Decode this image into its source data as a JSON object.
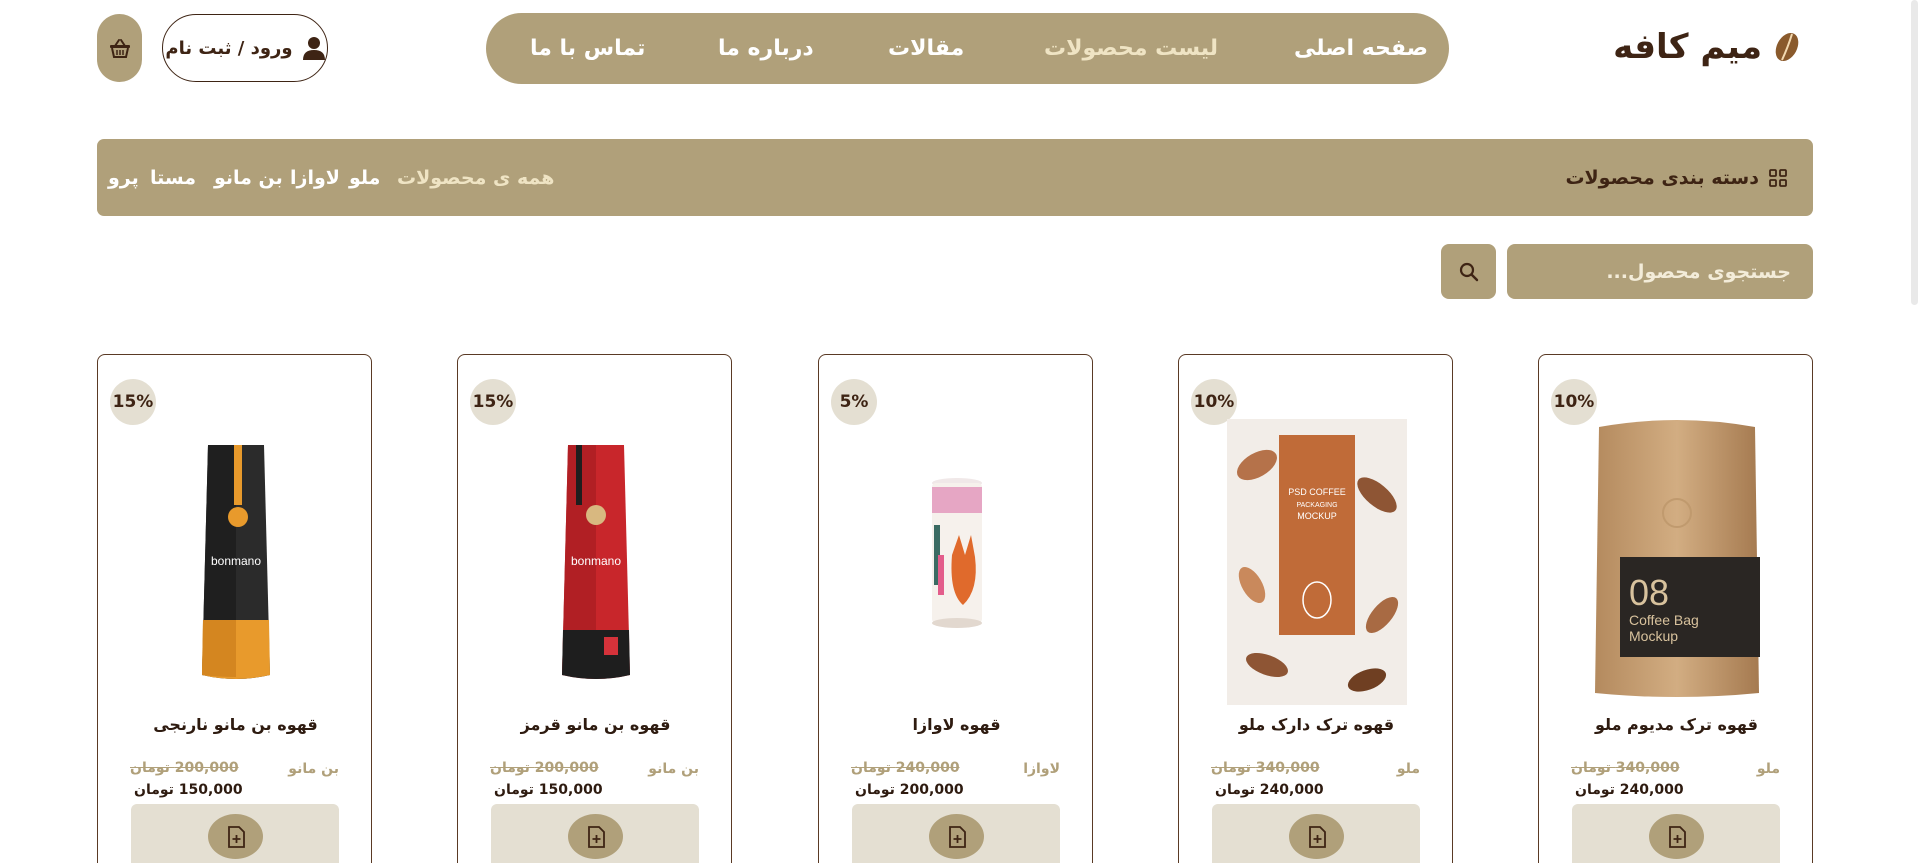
{
  "header": {
    "brand_name": "میم کافه",
    "nav": [
      {
        "label": "صفحه اصلی"
      },
      {
        "label": "لیست محصولات"
      },
      {
        "label": "مقالات"
      },
      {
        "label": "درباره ما"
      },
      {
        "label": "تماس با ما"
      }
    ],
    "active_nav": "لیست محصولات",
    "login_label": "ورود / ثبت نام"
  },
  "categories": {
    "title": "دسته بندی محصولات",
    "items": [
      {
        "label": "همه ی محصولات"
      },
      {
        "label": "ملو"
      },
      {
        "label": "لاوازا"
      },
      {
        "label": "بن مانو"
      },
      {
        "label": "مستا"
      },
      {
        "label": "پرو"
      }
    ],
    "active": "همه ی محصولات"
  },
  "search": {
    "placeholder": "جستجوی محصول..."
  },
  "products": [
    {
      "name": "قهوه ترک مدیوم ملو",
      "brand": "ملو",
      "discount": "10%",
      "old_price": "340,000 تومان",
      "new_price": "240,000 تومان",
      "image": "kraft-coffee-bag"
    },
    {
      "name": "قهوه ترک دارک ملو",
      "brand": "ملو",
      "discount": "10%",
      "old_price": "340,000 تومان",
      "new_price": "240,000 تومان",
      "image": "leaf-pattern-coffee-pouch"
    },
    {
      "name": "قهوه لاوازا",
      "brand": "لاوازا",
      "discount": "5%",
      "old_price": "240,000 تومان",
      "new_price": "200,000 تومان",
      "image": "fox-coffee-can"
    },
    {
      "name": "قهوه بن مانو قرمز",
      "brand": "بن مانو",
      "discount": "15%",
      "old_price": "200,000 تومان",
      "new_price": "150,000 تومان",
      "image": "red-bonmano-bag"
    },
    {
      "name": "قهوه بن مانو نارنجی",
      "brand": "بن مانو",
      "discount": "15%",
      "old_price": "200,000 تومان",
      "new_price": "150,000 تومان",
      "image": "orange-bonmano-bag"
    }
  ],
  "colors": {
    "accent": "#b0a07a",
    "dark": "#3e2414",
    "light_panel": "#e4dfd2",
    "active_text": "#efe4c4"
  }
}
